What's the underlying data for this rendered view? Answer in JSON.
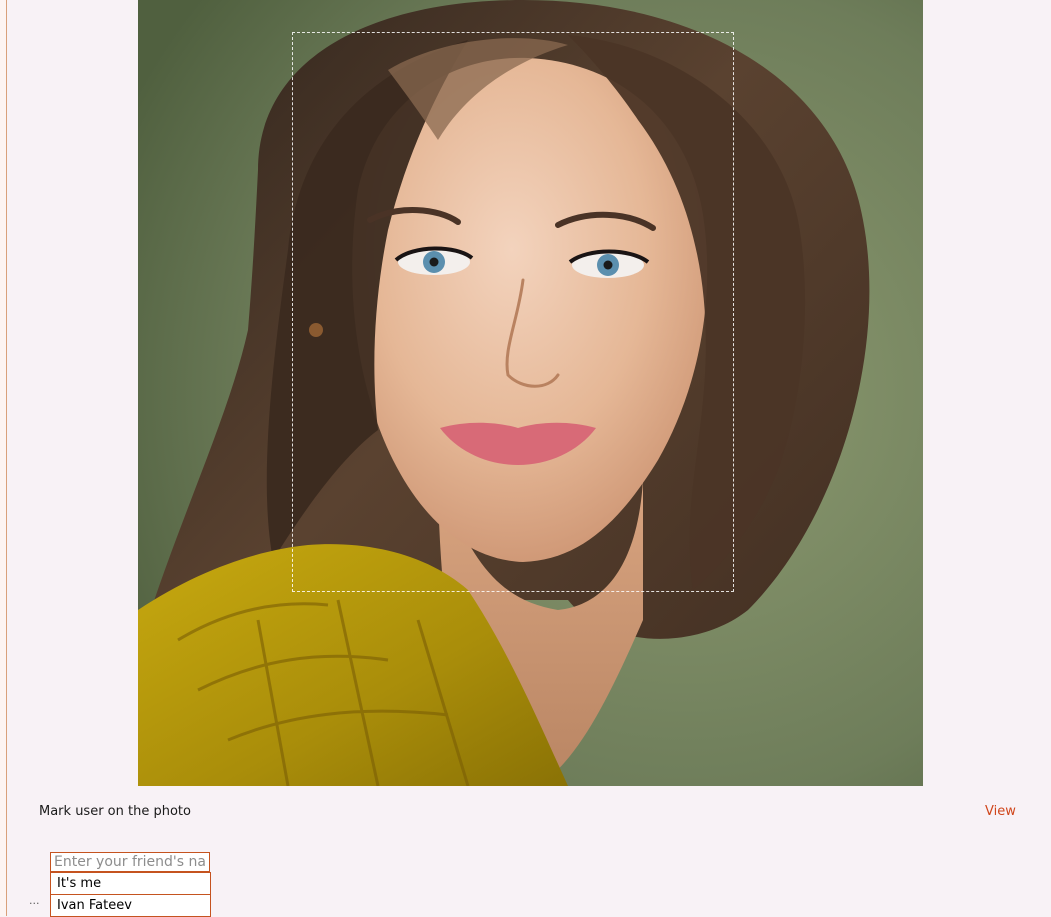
{
  "photo": {
    "alt": "User photo"
  },
  "tagging": {
    "instruction": "Mark user on the photo",
    "view_label": "View",
    "more_label": "...",
    "input": {
      "placeholder": "Enter your friend's name",
      "value": ""
    },
    "suggestions": [
      "It's me",
      "Ivan Fateev"
    ]
  },
  "colors": {
    "accent": "#c5531f",
    "link": "#d0461b",
    "page_background": "#f8f2f6"
  }
}
